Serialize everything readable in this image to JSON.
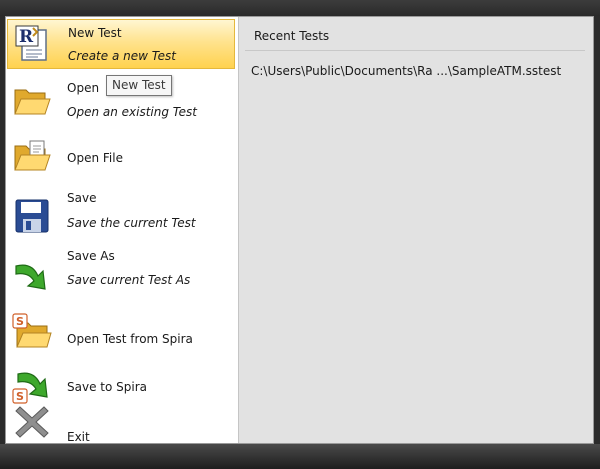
{
  "menu": {
    "new_test": {
      "label": "New Test",
      "description": "Create a new Test"
    },
    "open": {
      "label": "Open",
      "description": "Open an existing Test"
    },
    "open_file": {
      "label": "Open File"
    },
    "save": {
      "label": "Save",
      "description": "Save the current Test"
    },
    "save_as": {
      "label": "Save As",
      "description": "Save current Test As"
    },
    "open_from_spira": {
      "label": "Open Test from Spira"
    },
    "save_to_spira": {
      "label": "Save to Spira"
    },
    "exit": {
      "label": "Exit"
    }
  },
  "tooltip": "New Test",
  "recent": {
    "heading": "Recent Tests",
    "files": [
      "C:\\Users\\Public\\Documents\\Ra ...\\SampleATM.sstest"
    ]
  },
  "icons": {
    "new_test": "new-test-document-icon",
    "open": "folder-open-icon",
    "open_file": "folder-file-icon",
    "save": "floppy-disk-icon",
    "save_as": "green-arrow-icon",
    "open_from_spira": "spira-folder-icon",
    "save_to_spira": "spira-arrow-icon",
    "exit": "close-x-icon"
  },
  "colors": {
    "hover_highlight": "#ffd24f",
    "right_pane_bg": "#e2e2e2",
    "window_chrome": "#2b2b2b"
  }
}
